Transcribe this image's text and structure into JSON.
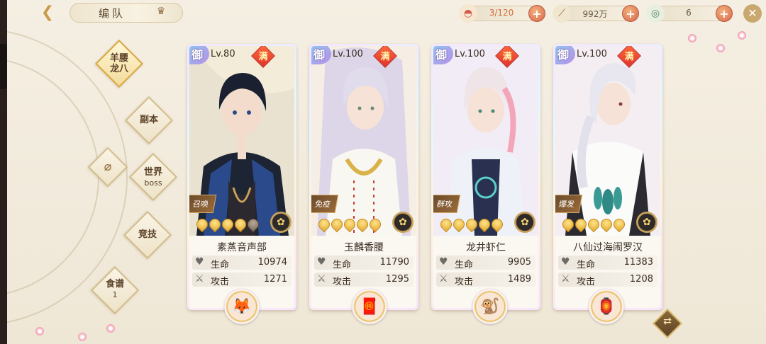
{
  "header": {
    "title": "编队",
    "resources": [
      {
        "icon": "bowl-icon",
        "value": "3/120"
      },
      {
        "icon": "chopsticks-icon",
        "value": "992万"
      },
      {
        "icon": "coin-icon",
        "value": "6"
      }
    ]
  },
  "nav": {
    "items": [
      {
        "label": "羊腰",
        "sub": "龙八",
        "active": true
      },
      {
        "label": "副本",
        "sub": ""
      },
      {
        "label": "世界",
        "sub": "boss"
      },
      {
        "label": "竞技",
        "sub": ""
      },
      {
        "label": "食谱",
        "sub": "1"
      }
    ]
  },
  "cards": [
    {
      "badge": "御",
      "level": "Lv.80",
      "full": "满",
      "tag": "召唤",
      "name": "素蒸音声部",
      "stars": 5,
      "hp_label": "生命",
      "hp": "10974",
      "atk_label": "攻击",
      "atk": "1271"
    },
    {
      "badge": "御",
      "level": "Lv.100",
      "full": "满",
      "tag": "免疫",
      "name": "玉麟香腰",
      "stars": 5,
      "hp_label": "生命",
      "hp": "11790",
      "atk_label": "攻击",
      "atk": "1295"
    },
    {
      "badge": "御",
      "level": "Lv.100",
      "full": "满",
      "tag": "群攻",
      "name": "龙井虾仁",
      "stars": 5,
      "hp_label": "生命",
      "hp": "9905",
      "atk_label": "攻击",
      "atk": "1489"
    },
    {
      "badge": "御",
      "level": "Lv.100",
      "full": "满",
      "tag": "爆发",
      "name": "八仙过海闹罗汉",
      "stars": 5,
      "hp_label": "生命",
      "hp": "11383",
      "atk_label": "攻击",
      "atk": "1208"
    }
  ],
  "colors": {
    "accent": "#d9674f",
    "gold": "#d9a73f",
    "text": "#3a2d22"
  }
}
